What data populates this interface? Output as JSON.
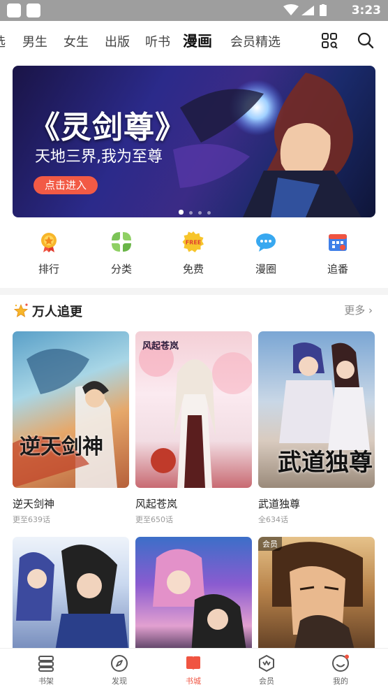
{
  "status_bar": {
    "time": "3:23"
  },
  "top_nav": {
    "tabs": [
      {
        "label": "选"
      },
      {
        "label": "男生"
      },
      {
        "label": "女生"
      },
      {
        "label": "出版"
      },
      {
        "label": "听书"
      },
      {
        "label": "漫画",
        "active": true
      },
      {
        "label": "会员精选"
      }
    ]
  },
  "banner": {
    "title": "《灵剑尊》",
    "subtitle": "天地三界,我为至尊",
    "button": "点击进入",
    "dots": 4,
    "active_dot": 0
  },
  "quick_links": [
    {
      "label": "排行",
      "icon": "medal-icon"
    },
    {
      "label": "分类",
      "icon": "grid-leaf-icon"
    },
    {
      "label": "免费",
      "icon": "free-badge-icon"
    },
    {
      "label": "漫圈",
      "icon": "chat-bubble-icon"
    },
    {
      "label": "追番",
      "icon": "calendar-icon"
    }
  ],
  "section": {
    "title": "万人追更",
    "more": "更多"
  },
  "comics": [
    {
      "title": "逆天剑神",
      "status": "更至639话",
      "cover_text": "逆天剑神"
    },
    {
      "title": "风起苍岚",
      "status": "更至650话",
      "cover_text": "风起苍岚"
    },
    {
      "title": "武道独尊",
      "status": "全634话",
      "cover_text": "武道独尊"
    },
    {
      "title": "",
      "status": "",
      "cover_text": ""
    },
    {
      "title": "",
      "status": "",
      "cover_text": ""
    },
    {
      "title": "",
      "status": "",
      "cover_text": "",
      "badge": "会员"
    }
  ],
  "bottom_nav": [
    {
      "label": "书架",
      "icon": "bookshelf-icon"
    },
    {
      "label": "发现",
      "icon": "compass-icon"
    },
    {
      "label": "书城",
      "icon": "bookstore-icon",
      "active": true
    },
    {
      "label": "会员",
      "icon": "vip-icon"
    },
    {
      "label": "我的",
      "icon": "profile-icon"
    }
  ],
  "colors": {
    "accent": "#f05441",
    "status_bar": "#9e9e9e"
  }
}
